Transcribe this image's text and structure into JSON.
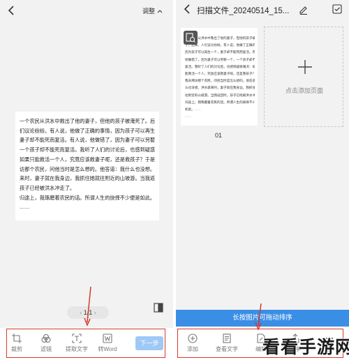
{
  "left": {
    "back_icon": "back-chevron-icon",
    "adjust_label": "调整",
    "doc_lines": [
      "一个农民从洪水中救出了他的妻子，但他的孩子被淹死了。后来，人",
      "们议论纷纷。有人说，他做了正确的事情，因为孩子可以再生一个，",
      "妻子却不能死而复活。有人说，他做错了，因为妻子可以另娶一个，",
      "一个孩子却不能死而复活。我听了人们的讨论后，也感到疑惑难决：",
      "如果只能救活一个人，究竟应该救妻子呢，还是救孩子？于是我去拜",
      "访那个农民，问他当时是怎么想的。他答道：我什么也没想。洪水袭",
      "来时，妻子就在我身边，我抓住她就往附近的山坡游。当我返回时，",
      "孩子已经被洪水冲走了。",
      "归途上，我琢磨着农民的话。所谓人生的抉择不少便是如此。",
      "……"
    ],
    "pager": {
      "prev": "‹",
      "text": "1/1",
      "next": "›"
    },
    "toolbar": [
      {
        "label": "裁剪",
        "icon": "crop-icon"
      },
      {
        "label": "滤镜",
        "icon": "filter-icon"
      },
      {
        "label": "提取文字",
        "icon": "extract-text-icon"
      },
      {
        "label": "转Word",
        "icon": "word-icon"
      }
    ],
    "next_label": "下一步"
  },
  "right": {
    "title": "扫描文件_20240514_15...",
    "thumb_lines": [
      "一个农民从洪水中救出了他的妻子，但他的孩子被淹死",
      "了。后来，人们议论纷纷。有人说，他做了正确的事情，",
      "因为孩子可以再生一个，妻子却不能死而复活。有人说，",
      "他做错了，因为妻子可以另娶一个，一个孩子却不能死而",
      "复活。我听了人们的讨论后，也感到疑惑难决：如果只",
      "能救活一个人，究竟应该救妻子呢，还是救孩子？于是",
      "我去拜访那个农民，问他当时是怎么想的。他答道：我什",
      "么也没想。洪水袭来时，妻子就在我身边，我抓住她就",
      "往附近的山坡游。当我返回时，孩子已经被洪水冲走了。",
      "归途上，我琢磨着农民的话。所谓人生的抉择不少便是",
      "如此。……",
      "……"
    ],
    "page_number": "01",
    "add_page_label": "点击添加页面",
    "hint": "长按图片可拖动排序",
    "toolbar": [
      {
        "label": "添加",
        "icon": "add-circle-icon"
      },
      {
        "label": "查看文字",
        "icon": "view-text-icon"
      },
      {
        "label": "编辑",
        "icon": "edit-doc-icon"
      },
      {
        "label": "分享",
        "icon": "share-icon"
      },
      {
        "label": "更多",
        "icon": "more-icon"
      }
    ]
  },
  "watermark": "看看手游网",
  "colors": {
    "accent": "#3a8ee6",
    "next_button": "#9ec9f7",
    "highlight": "#d9372b"
  }
}
